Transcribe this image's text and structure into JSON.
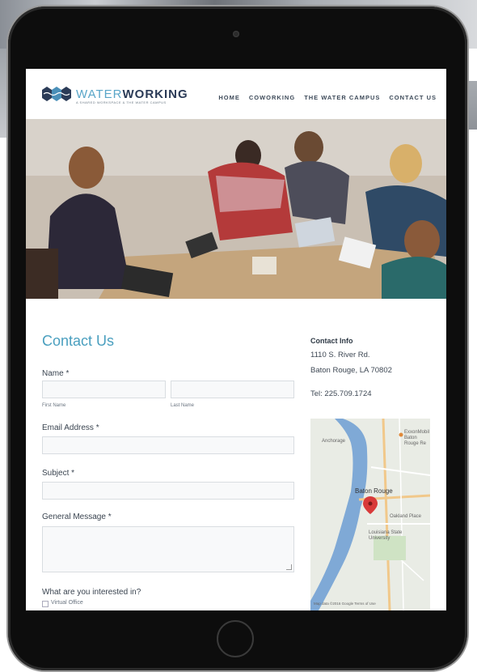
{
  "header": {
    "logo_light": "WATER",
    "logo_bold": "WORKING",
    "logo_tagline": "A SHARED WORKSPACE & THE WATER CAMPUS",
    "nav": [
      "HOME",
      "COWORKING",
      "THE WATER CAMPUS",
      "CONTACT US"
    ]
  },
  "form": {
    "title": "Contact Us",
    "name_label": "Name *",
    "first_name_sublabel": "First Name",
    "last_name_sublabel": "Last Name",
    "email_label": "Email Address *",
    "subject_label": "Subject *",
    "message_label": "General Message *",
    "interest_label": "What are you interested in?",
    "interest_option_1": "Virtual Office"
  },
  "contact_info": {
    "title": "Contact Info",
    "address_1": "1110 S. River Rd.",
    "address_2": "Baton Rouge, LA 70802",
    "phone": "Tel: 225.709.1724"
  },
  "map": {
    "city_label": "Baton Rouge",
    "labels": [
      "Anchorage",
      "ExxonMobil Baton Rouge Re",
      "Louisiana State University",
      "Oakland Place"
    ],
    "attribution": "Map data ©2016 Google  Terms of Use"
  },
  "colors": {
    "accent": "#4a9fbf",
    "logo_dark": "#2b3b57",
    "river": "#7fa9d6",
    "pin": "#d83a3a"
  }
}
